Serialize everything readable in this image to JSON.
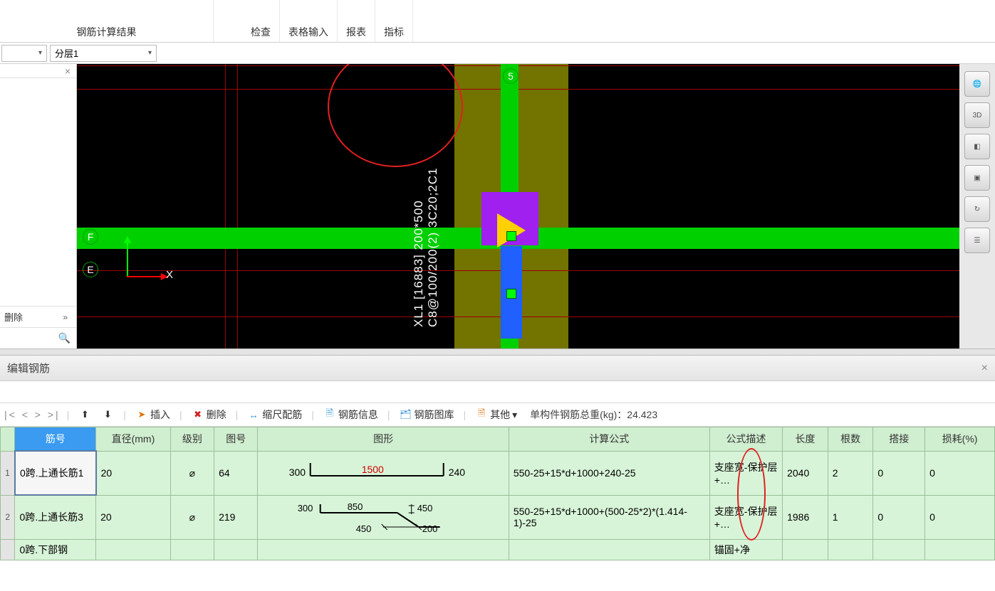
{
  "ribbon": {
    "groups": [
      "钢筋计算结果",
      "检查",
      "表格输入",
      "报表",
      "指标"
    ]
  },
  "dropdown": {
    "layer_label": "分层1"
  },
  "left_panel": {
    "delete_label": "删除"
  },
  "viewport": {
    "grid_5": "5",
    "grid_F": "F",
    "grid_E": "E",
    "axis_x": "X",
    "beam_text_line1": "XL1 [16883] 200*500",
    "beam_text_line2": "C8@100/200(2) 3C20;2C1"
  },
  "right_toolbar": {
    "btns": [
      "",
      "3D",
      "",
      "",
      "↻",
      ""
    ]
  },
  "bottom": {
    "title": "编辑钢筋",
    "nav": "|< < > >|",
    "insert": "插入",
    "delete": "删除",
    "scale": "缩尺配筋",
    "info": "钢筋信息",
    "lib": "钢筋图库",
    "other": "其他",
    "other_caret": "▾",
    "weight_label": "单构件钢筋总重(kg)：",
    "weight_value": "24.423",
    "columns": {
      "name": "筋号",
      "dia": "直径(mm)",
      "grade": "级别",
      "fig": "图号",
      "shape": "图形",
      "formula": "计算公式",
      "desc": "公式描述",
      "len": "长度",
      "count": "根数",
      "lap": "搭接",
      "loss": "损耗(%)"
    },
    "rows": [
      {
        "idx": "1",
        "name": "0跨.上通长筋1",
        "dia": "20",
        "grade": "⌀",
        "fig": "64",
        "shape": {
          "left": "300",
          "mid": "1500",
          "right": "240"
        },
        "formula": "550-25+15*d+1000+240-25",
        "desc": "支座宽-保护层+…",
        "len": "2040",
        "count": "2",
        "lap": "0",
        "loss": "0"
      },
      {
        "idx": "2",
        "name": "0跨.上通长筋3",
        "dia": "20",
        "grade": "⌀",
        "fig": "219",
        "shape": {
          "a": "300",
          "b": "850",
          "c": "450",
          "d": "450",
          "e": "200"
        },
        "formula": "550-25+15*d+1000+(500-25*2)*(1.414-1)-25",
        "desc": "支座宽-保护层+…",
        "len": "1986",
        "count": "1",
        "lap": "0",
        "loss": "0"
      },
      {
        "idx": "",
        "name": "0跨.下部钢",
        "desc": "锚固+净"
      }
    ]
  }
}
